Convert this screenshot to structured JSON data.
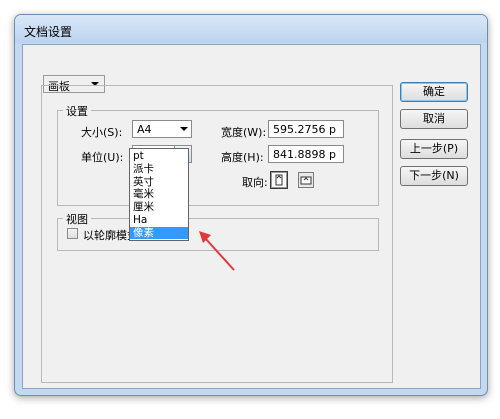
{
  "window": {
    "title": "文档设置"
  },
  "artboard_select": {
    "value": "画板"
  },
  "settings": {
    "group_label": "设置",
    "size_label": "大小(S):",
    "size_value": "A4",
    "unit_label": "单位(U):",
    "unit_value": "像素",
    "width_label": "宽度(W):",
    "width_value": "595.2756 p",
    "height_label": "高度(H):",
    "height_value": "841.8898 p",
    "orientation_label": "取向:"
  },
  "unit_dropdown": {
    "options": [
      "pt",
      "派卡",
      "英寸",
      "毫米",
      "厘米",
      "Ha",
      "像素"
    ],
    "selected": "像素"
  },
  "view": {
    "group_label": "视图",
    "outline_checkbox_label": "以轮廓模式"
  },
  "buttons": {
    "ok": "确定",
    "cancel": "取消",
    "prev": "上一步(P)",
    "next": "下一步(N)"
  },
  "colors": {
    "selection": "#3399ff",
    "arrow": "#e0393b"
  }
}
